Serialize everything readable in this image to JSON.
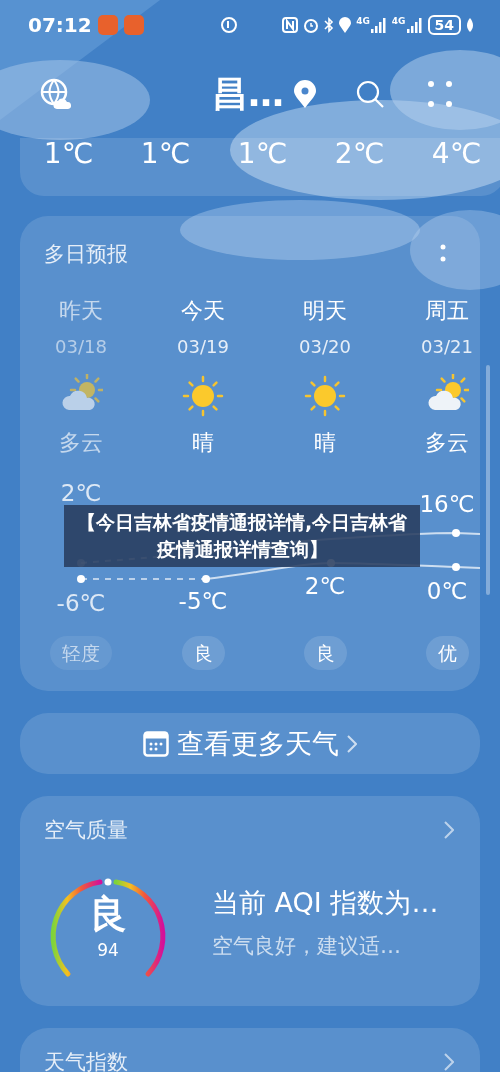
{
  "status_bar": {
    "time": "07:12",
    "signal_labels": [
      "4G",
      "4G"
    ],
    "battery": "54"
  },
  "header": {
    "city": "昌…"
  },
  "hourly": {
    "temps": [
      "1℃",
      "1℃",
      "1℃",
      "2℃",
      "4℃"
    ]
  },
  "forecast": {
    "title": "多日预报",
    "days": [
      {
        "label": "昨天",
        "date": "03/18",
        "kind": "cloudy",
        "weather": "多云",
        "high": "2℃",
        "low": "-6℃",
        "aqi": "轻度",
        "past": true
      },
      {
        "label": "今天",
        "date": "03/19",
        "kind": "sunny",
        "weather": "晴",
        "low": "-5℃",
        "aqi": "良",
        "past": false
      },
      {
        "label": "明天",
        "date": "03/20",
        "kind": "sunny",
        "weather": "晴",
        "low": "2℃",
        "aqi": "良",
        "past": false
      },
      {
        "label": "周五",
        "date": "03/21",
        "kind": "cloudy",
        "weather": "多云",
        "high": "16℃",
        "low": "0℃",
        "aqi": "优",
        "past": false
      }
    ]
  },
  "banner": {
    "text": "【今日吉林省疫情通报详情,今日吉林省疫情通报详情查询】"
  },
  "more_weather": {
    "label": "查看更多天气"
  },
  "air_quality": {
    "title": "空气质量",
    "level": "良",
    "aqi": "94",
    "headline": "当前 AQI 指数为…",
    "advice": "空气良好，建议适…"
  },
  "weather_index": {
    "title": "天气指数"
  }
}
